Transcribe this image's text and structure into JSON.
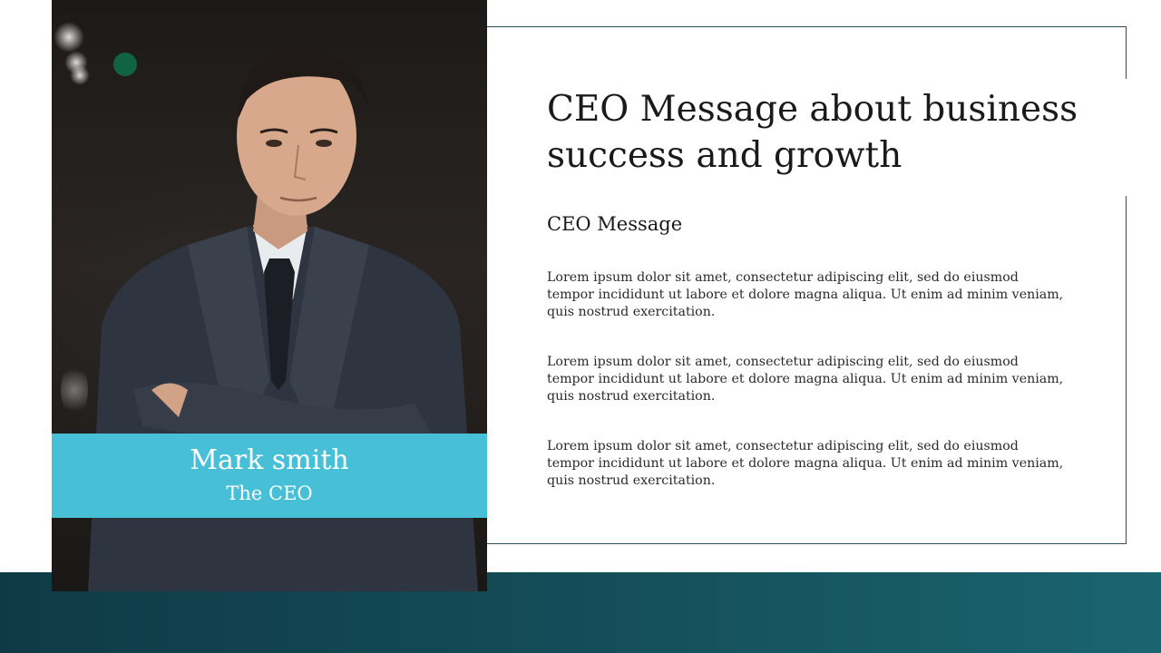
{
  "slide": {
    "title": "CEO Message about business success and growth",
    "subtitle": "CEO Message",
    "paragraphs": [
      "Lorem ipsum dolor sit amet, consectetur adipiscing elit, sed do eiusmod tempor incididunt ut labore et dolore magna aliqua. Ut enim ad minim veniam, quis nostrud exercitation.",
      "Lorem ipsum dolor sit amet, consectetur adipiscing elit, sed do eiusmod tempor incididunt ut labore et dolore magna aliqua. Ut enim ad minim veniam, quis nostrud exercitation.",
      "Lorem ipsum dolor sit amet, consectetur adipiscing elit, sed do eiusmod tempor incididunt ut labore et dolore magna aliqua. Ut enim ad minim veniam, quis nostrud exercitation."
    ]
  },
  "profile": {
    "name": "Mark smith",
    "role": "The CEO"
  },
  "colors": {
    "accent": "#47bfd6",
    "band": "#134b57",
    "frame": "#2a4f5c",
    "text": "#1a1a1a"
  }
}
